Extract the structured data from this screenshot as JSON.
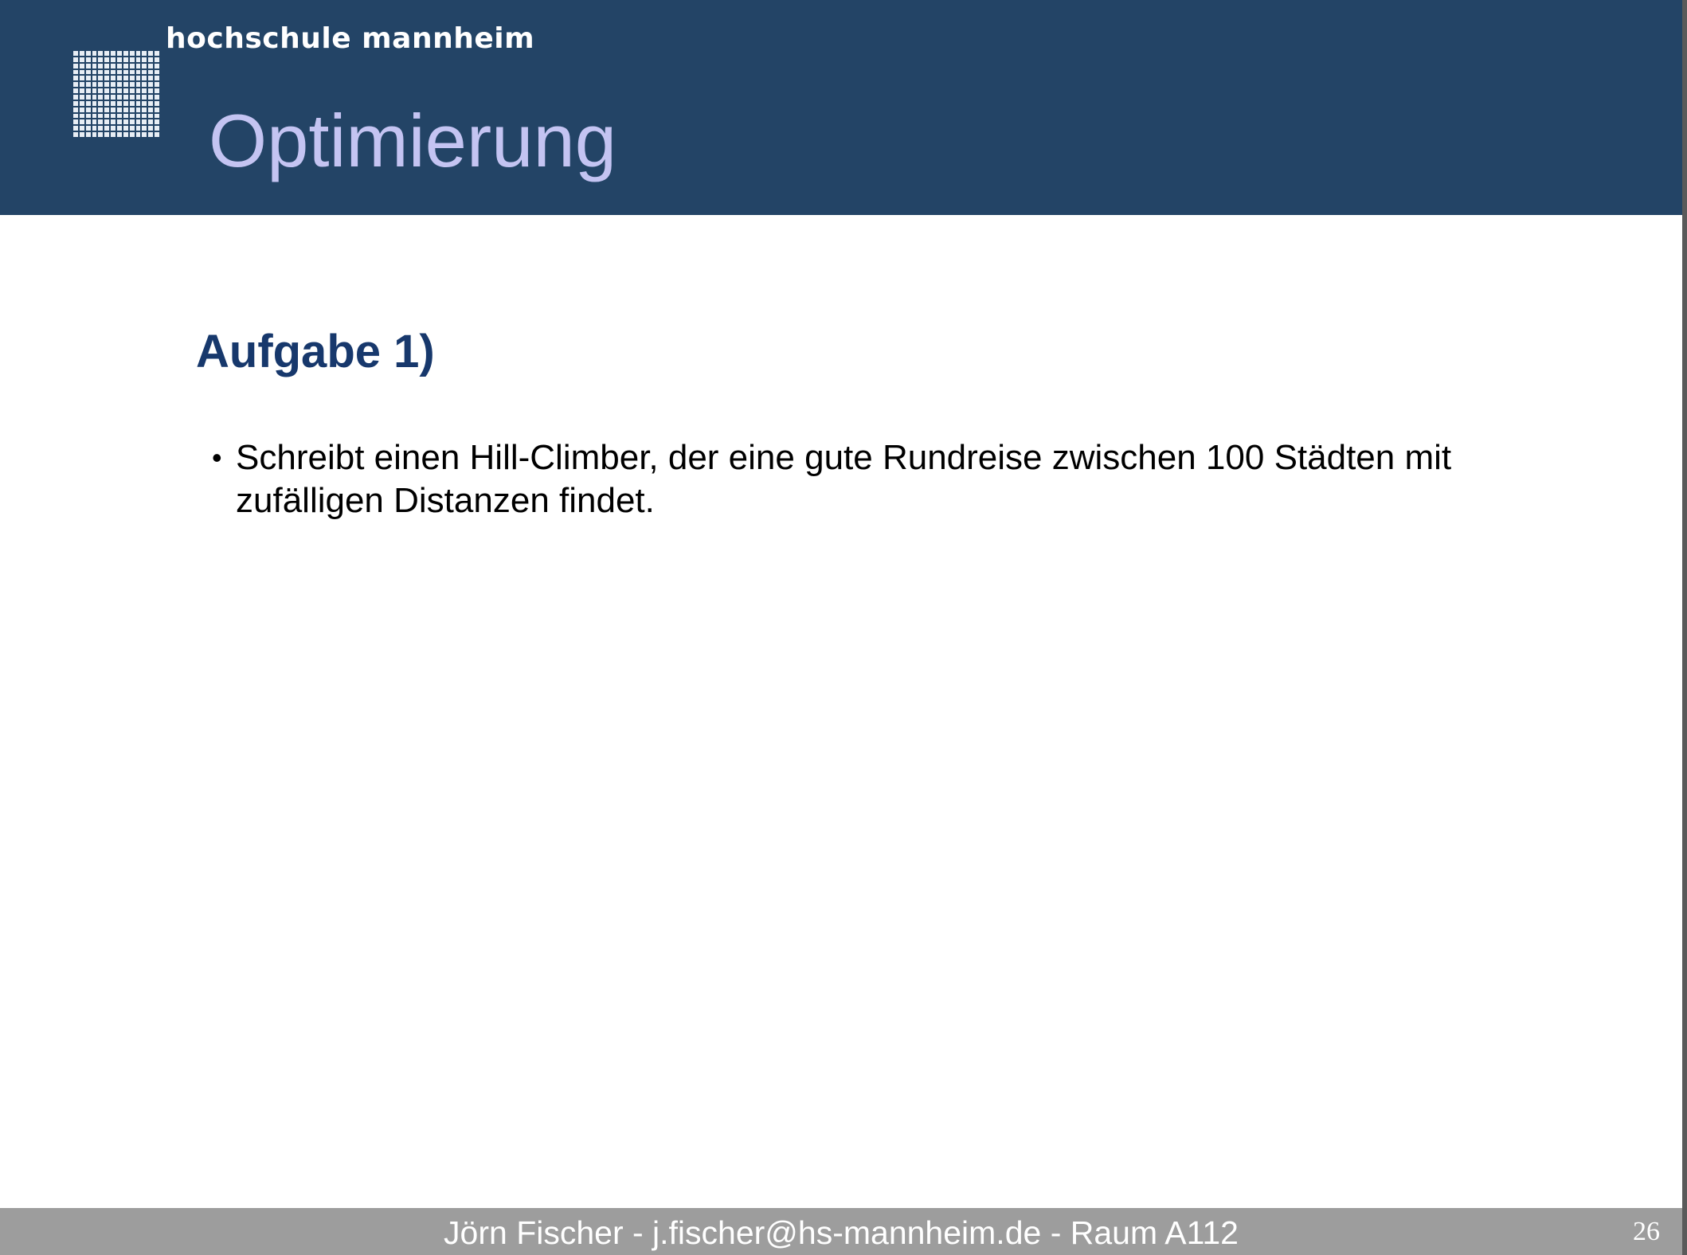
{
  "header": {
    "institution": "hochschule mannheim",
    "title": "Optimierung",
    "background_color": "#234466",
    "title_color": "#c4c4f2"
  },
  "logo": {
    "name": "hochschule-mannheim-logo"
  },
  "content": {
    "heading": "Aufgabe 1)",
    "heading_color": "#17386c",
    "bullets": [
      {
        "marker": "•",
        "text": "Schreibt einen Hill-Climber, der eine gute Rundreise zwischen 100 Städten mit zufälligen Distanzen findet."
      }
    ]
  },
  "footer": {
    "text": "Jörn Fischer  -  j.fischer@hs-mannheim.de - Raum A112",
    "page_number": "26",
    "background_color": "#9d9d9d"
  }
}
